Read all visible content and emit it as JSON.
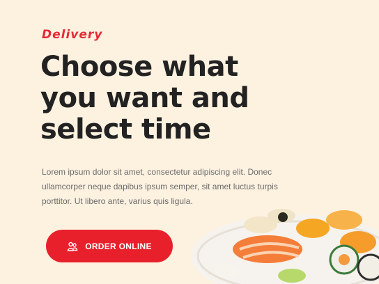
{
  "hero": {
    "eyebrow": "Delivery",
    "headline": "Choose what you want and select time",
    "description": "Lorem ipsum dolor sit amet, consectetur adipiscing elit. Donec ullamcorper neque dapibus ipsum semper, sit amet luctus turpis porttitor. Ut libero ante, varius quis ligula.",
    "cta_label": "ORDER ONLINE",
    "cta_icon": "people-icon",
    "image": "sushi-plate"
  },
  "colors": {
    "background": "#fdf1e0",
    "accent": "#e8202c",
    "headline": "#222222",
    "body_text": "#6b6b6b"
  }
}
